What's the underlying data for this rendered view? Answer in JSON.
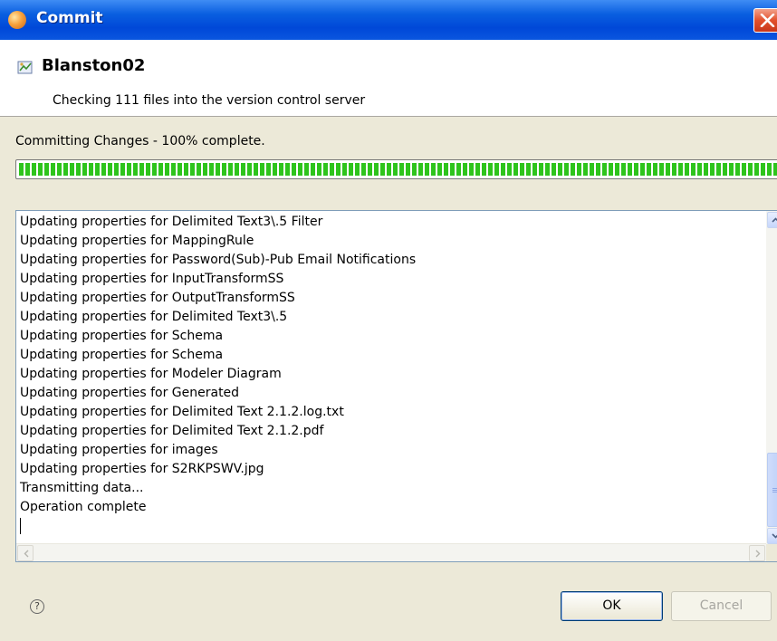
{
  "window": {
    "title": "Commit"
  },
  "header": {
    "title": "Blanston02",
    "subtitle": "Checking 111 files into the version control server"
  },
  "progress": {
    "label": "Committing Changes - 100% complete.",
    "percent": 100,
    "color": "#2ec41c"
  },
  "log": {
    "lines": [
      "Updating properties for Delimited Text3\\.5 Filter",
      "Updating properties for MappingRule",
      "Updating properties for Password(Sub)-Pub Email Notifications",
      "Updating properties for InputTransformSS",
      "Updating properties for OutputTransformSS",
      "Updating properties for Delimited Text3\\.5",
      "Updating properties for Schema",
      "Updating properties for Schema",
      "Updating properties for Modeler Diagram",
      "Updating properties for Generated",
      "Updating properties for Delimited Text 2.1.2.log.txt",
      "Updating properties for Delimited Text 2.1.2.pdf",
      "Updating properties for images",
      "Updating properties for S2RKPSWV.jpg",
      "Transmitting data...",
      "Operation complete"
    ]
  },
  "footer": {
    "help_icon": "question-mark-icon",
    "help_glyph": "?",
    "ok_label": "OK",
    "cancel_label": "Cancel"
  }
}
